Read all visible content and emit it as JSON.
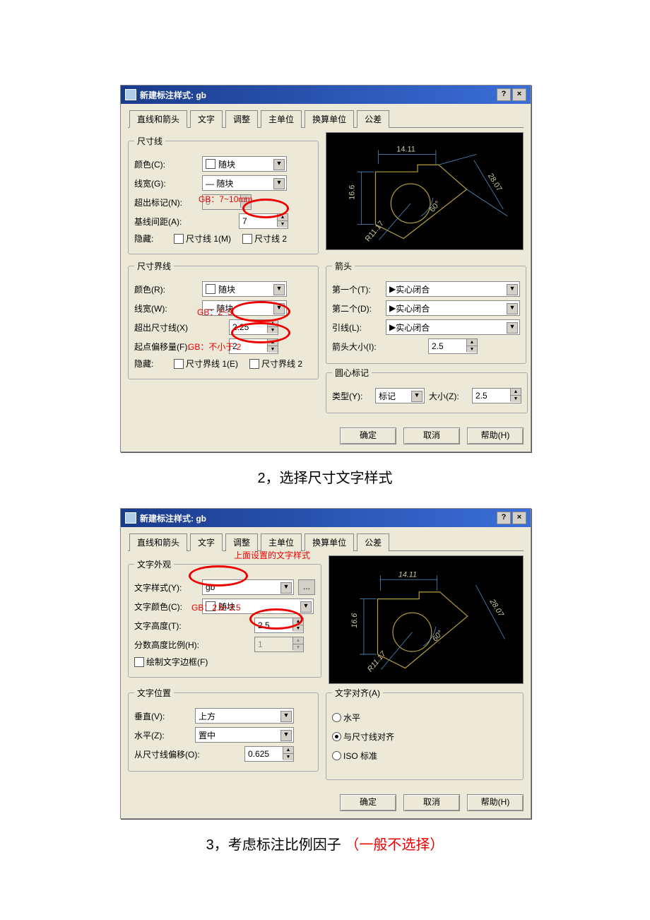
{
  "dialog1": {
    "title": "新建标注样式: gb",
    "btn_help": "?",
    "btn_close": "×",
    "tabs": [
      "直线和箭头",
      "文字",
      "调整",
      "主单位",
      "换算单位",
      "公差"
    ],
    "active_tab": 0,
    "group_dimline": "尺寸线",
    "color_label": "颜色(C):",
    "color_value": "随块",
    "lw_label": "线宽(G):",
    "lw_value": "— 随块",
    "extend_label": "超出标记(N):",
    "extend_value": "0",
    "baseline_label": "基线间距(A):",
    "baseline_value": "7",
    "hide_label": "隐藏:",
    "hide_d1": "尺寸线 1(M)",
    "hide_d2": "尺寸线 2",
    "group_extline": "尺寸界线",
    "ext_color_label": "颜色(R):",
    "ext_color_value": "随块",
    "ext_lw_label": "线宽(W):",
    "ext_lw_value": "— 随块",
    "ext_beyond_label": "超出尺寸线(X)",
    "ext_beyond_value": "2.25",
    "ext_offset_label": "起点偏移量(F):",
    "ext_offset_value": "2",
    "ext_hide1": "尺寸界线 1(E)",
    "ext_hide2": "尺寸界线 2",
    "group_arrow": "箭头",
    "arrow1_label": "第一个(T):",
    "arrow1_value": "实心闭合",
    "arrow2_label": "第二个(D):",
    "arrow2_value": "实心闭合",
    "leader_label": "引线(L):",
    "leader_value": "实心闭合",
    "arrow_size_label": "箭头大小(I):",
    "arrow_size_value": "2.5",
    "group_center": "圆心标记",
    "center_type_label": "类型(Y):",
    "center_type_value": "标记",
    "center_size_label": "大小(Z):",
    "center_size_value": "2.5",
    "annot_gb1": "GB：7~10mm",
    "annot_gb2": "GB：2~3",
    "annot_gb3": "GB：不小于 2",
    "ok": "确定",
    "cancel": "取消",
    "help": "帮助(H)",
    "preview": {
      "a": "14.11",
      "b": "16.6",
      "c": "28.07",
      "d": "60°",
      "e": "R11.17"
    }
  },
  "caption1": "2，选择尺寸文字样式",
  "dialog2": {
    "title": "新建标注样式: gb",
    "btn_help": "?",
    "btn_close": "×",
    "tabs": [
      "直线和箭头",
      "文字",
      "调整",
      "主单位",
      "换算单位",
      "公差"
    ],
    "active_tab": 1,
    "group_appear": "文字外观",
    "style_label": "文字样式(Y):",
    "style_value": "gb",
    "tcolor_label": "文字颜色(C):",
    "tcolor_value": "随块",
    "height_label": "文字高度(T):",
    "height_value": "2.5",
    "frac_label": "分数高度比例(H):",
    "frac_value": "1",
    "frame_chk": "绘制文字边框(F)",
    "group_pos": "文字位置",
    "vert_label": "垂直(V):",
    "vert_value": "上方",
    "horz_label": "水平(Z):",
    "horz_value": "置中",
    "offset_label": "从尺寸线偏移(O):",
    "offset_value": "0.625",
    "group_align": "文字对齐(A)",
    "radio1": "水平",
    "radio2": "与尺寸线对齐",
    "radio3": "ISO 标准",
    "annot_top": "上面设置的文字样式",
    "annot_gb_h": "GB：2.5~3.5",
    "ok": "确定",
    "cancel": "取消",
    "help": "帮助(H)",
    "preview": {
      "a": "14.11",
      "b": "16.6",
      "c": "28.07",
      "d": "60°",
      "e": "R11.17"
    }
  },
  "caption2_a": "3，考虑标注比例因子  ",
  "caption2_b": "（一般不选择）"
}
